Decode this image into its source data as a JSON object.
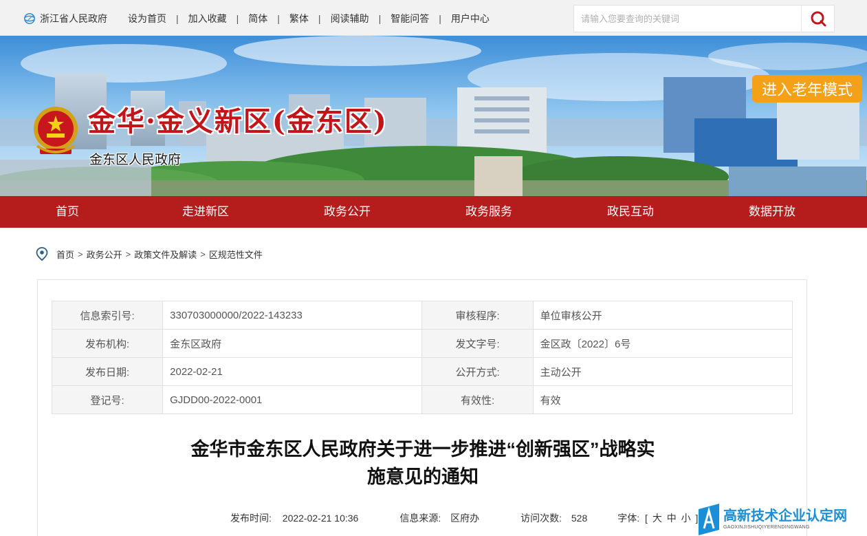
{
  "topbar": {
    "province_link": "浙江省人民政府",
    "links": [
      "设为首页",
      "加入收藏",
      "简体",
      "繁体",
      "阅读辅助",
      "智能问答",
      "用户中心"
    ],
    "separator": "|",
    "search_placeholder": "请输入您要查询的关键词"
  },
  "banner": {
    "title": "金华·金义新区(金东区)",
    "subtitle": "金东区人民政府",
    "elder_mode": "进入老年模式"
  },
  "nav": [
    "首页",
    "走进新区",
    "政务公开",
    "政务服务",
    "政民互动",
    "数据开放"
  ],
  "breadcrumb": {
    "items": [
      "首页",
      "政务公开",
      "政策文件及解读",
      "区规范性文件"
    ],
    "separator": ">"
  },
  "info_table": [
    {
      "k1": "信息索引号:",
      "v1": "330703000000/2022-143233",
      "k2": "审核程序:",
      "v2": "单位审核公开"
    },
    {
      "k1": "发布机构:",
      "v1": "金东区政府",
      "k2": "发文字号:",
      "v2": "金区政〔2022〕6号"
    },
    {
      "k1": "发布日期:",
      "v1": "2022-02-21",
      "k2": "公开方式:",
      "v2": "主动公开"
    },
    {
      "k1": "登记号:",
      "v1": "GJDD00-2022-0001",
      "k2": "有效性:",
      "v2": "有效"
    }
  ],
  "document": {
    "title_line1": "金华市金东区人民政府关于进一步推进“创新强区”战略实",
    "title_line2": "施意见的通知",
    "publish_label": "发布时间:",
    "publish_time": "2022-02-21 10:36",
    "source_label": "信息来源:",
    "source": "区府办",
    "visits_label": "访问次数:",
    "visits": "528",
    "font_label": "字体:",
    "font_open": "[",
    "font_large": "大",
    "font_medium": "中",
    "font_small": "小",
    "font_close": "]"
  },
  "watermark": {
    "main": "高新技术企业认定网",
    "pinyin": "GAOXINJISHUQIYERENDINGWANG"
  },
  "colors": {
    "nav_red": "#b51c1c",
    "elder_orange": "#f5a118",
    "brand_red": "#c3141a",
    "watermark_blue": "#1a8fd8"
  }
}
